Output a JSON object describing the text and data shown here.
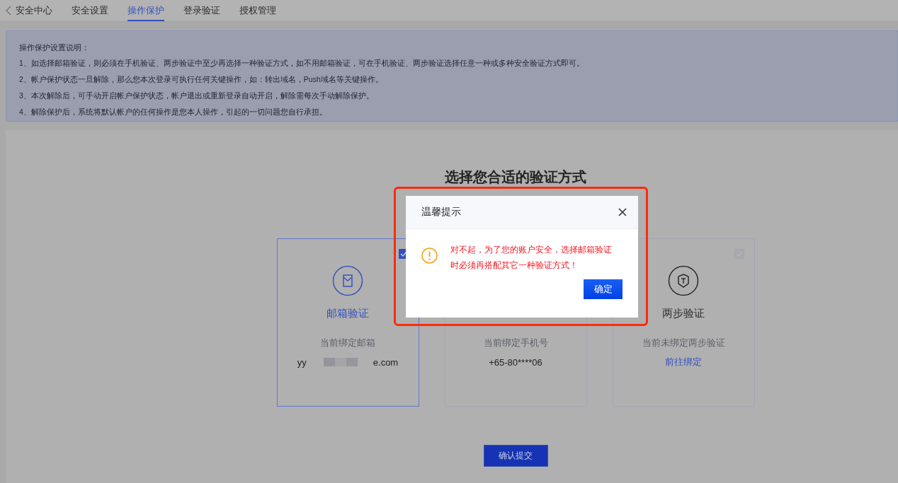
{
  "tabs": [
    {
      "label": "安全中心",
      "kind": "back",
      "selected": false
    },
    {
      "label": "安全设置",
      "kind": "tab",
      "selected": false
    },
    {
      "label": "操作保护",
      "kind": "tab",
      "selected": true
    },
    {
      "label": "登录验证",
      "kind": "tab",
      "selected": false
    },
    {
      "label": "授权管理",
      "kind": "tab",
      "selected": false
    }
  ],
  "notice": {
    "title": "操作保护设置说明：",
    "lines": [
      "1、如选择邮箱验证，则必须在手机验证、两步验证中至少再选择一种验证方式，如不用邮箱验证，可在手机验证、两步验证选择任意一种或多种安全验证方式即可。",
      "2、帐户保护状态一旦解除，那么您本次登录可执行任何关键操作，如：转出域名，Push域名等关键操作。",
      "3、本次解除后，可手动开启帐户保护状态，帐户退出或重新登录自动开启，解除需每次手动解除保护。",
      "4、解除保护后，系统将默认帐户的任何操作是您本人操作，引起的一切问题您自行承担。"
    ]
  },
  "heading": "选择您合适的验证方式",
  "cards": [
    {
      "kind": "email",
      "title": "邮箱验证",
      "selected": true,
      "checked": true,
      "subtitle": "当前绑定邮箱",
      "detail": {
        "kind": "masked",
        "before": "yy",
        "after": "e.com"
      }
    },
    {
      "subtitle": "当前绑定手机号",
      "selected": false,
      "detail": {
        "kind": "text",
        "text": "+65-80****06"
      }
    },
    {
      "kind": "two_step",
      "title": "两步验证",
      "selected": false,
      "checked": false,
      "subtitle": "当前未绑定两步验证",
      "detail": {
        "kind": "link",
        "text": "前往绑定"
      }
    }
  ],
  "submit": "确认提交",
  "dialog": {
    "title": "温馨提示",
    "message": "对不起，为了您的账户安全，选择邮箱验证时必须再搭配其它一种验证方式！",
    "confirm": "确定"
  }
}
